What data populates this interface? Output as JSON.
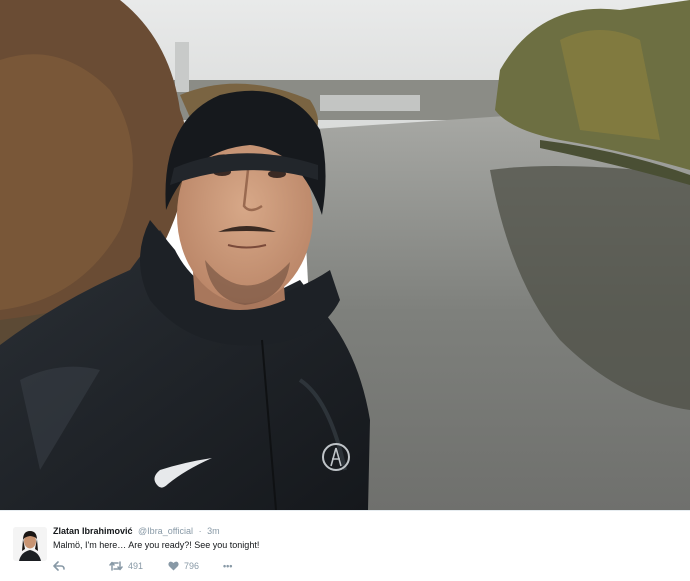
{
  "tweet": {
    "fullname": "Zlatan Ibrahimović",
    "handle": "@Ibra_official",
    "separator": "·",
    "time": "3m",
    "text": "Malmö, I'm here… Are you ready?! See you tonight!",
    "retweets": "491",
    "likes": "796",
    "more": "•••"
  },
  "icons": {
    "reply": "reply-icon",
    "retweet": "retweet-icon",
    "like": "heart-icon",
    "more": "more-icon"
  },
  "colors": {
    "text": "#14171a",
    "secondary": "#8899a6"
  },
  "photo": {
    "subject": "selfie by a canal",
    "crest_color": "#bfc4c8"
  }
}
